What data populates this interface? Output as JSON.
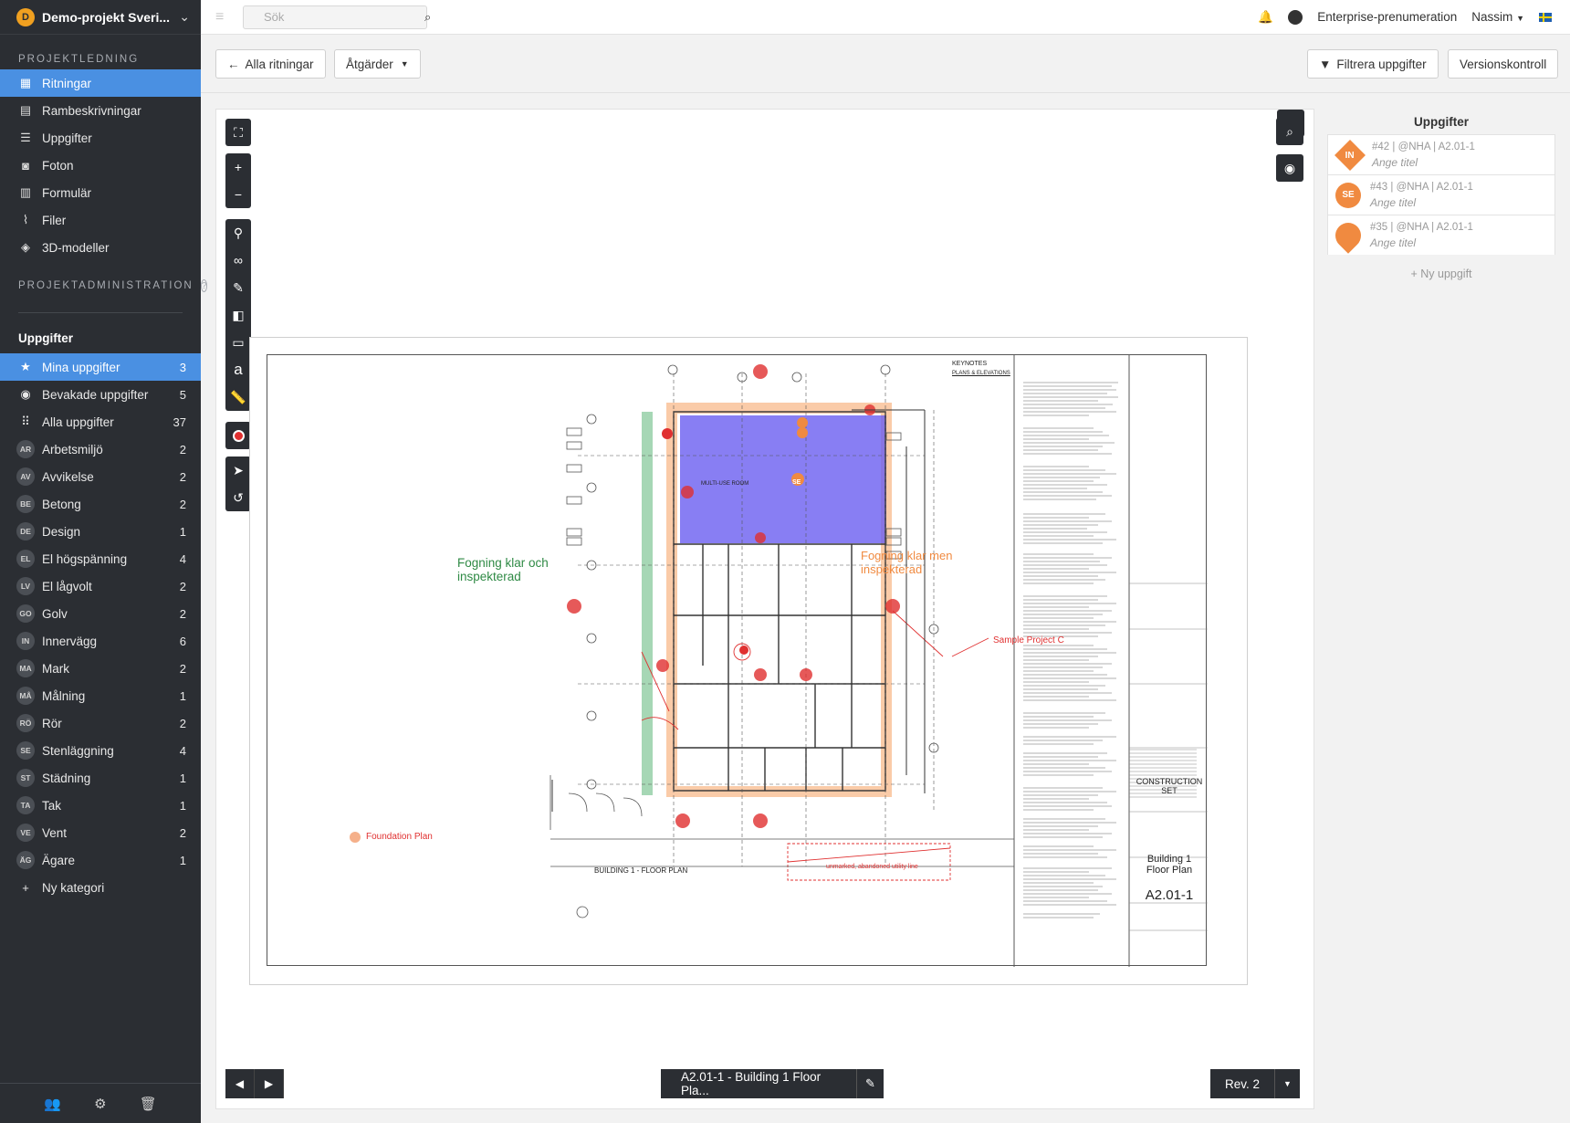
{
  "project": {
    "name": "Demo-projekt Sveri...",
    "logo_letter": "D"
  },
  "sidebar": {
    "section1_title": "PROJEKTLEDNING",
    "nav": [
      {
        "label": "Ritningar",
        "icon": "drawings-icon",
        "active": true
      },
      {
        "label": "Rambeskrivningar",
        "icon": "document-icon"
      },
      {
        "label": "Uppgifter",
        "icon": "list-icon"
      },
      {
        "label": "Foton",
        "icon": "camera-icon"
      },
      {
        "label": "Formulär",
        "icon": "clipboard-icon"
      },
      {
        "label": "Filer",
        "icon": "paperclip-icon"
      },
      {
        "label": "3D-modeller",
        "icon": "cube-icon"
      }
    ],
    "section2_title": "PROJEKTADMINISTRATION",
    "section2_help": "?",
    "tasks_heading": "Uppgifter",
    "filters": [
      {
        "label": "Mina uppgifter",
        "count": "3",
        "icon": "★",
        "active": true
      },
      {
        "label": "Bevakade uppgifter",
        "count": "5",
        "icon": "👁"
      },
      {
        "label": "Alla uppgifter",
        "count": "37",
        "icon": "⋮⋮"
      }
    ],
    "categories": [
      {
        "code": "AR",
        "label": "Arbetsmiljö",
        "count": "2"
      },
      {
        "code": "AV",
        "label": "Avvikelse",
        "count": "2"
      },
      {
        "code": "BE",
        "label": "Betong",
        "count": "2"
      },
      {
        "code": "DE",
        "label": "Design",
        "count": "1"
      },
      {
        "code": "EL",
        "label": "El högspänning",
        "count": "4"
      },
      {
        "code": "LV",
        "label": "El lågvolt",
        "count": "2"
      },
      {
        "code": "GO",
        "label": "Golv",
        "count": "2"
      },
      {
        "code": "IN",
        "label": "Innervägg",
        "count": "6"
      },
      {
        "code": "MA",
        "label": "Mark",
        "count": "2"
      },
      {
        "code": "MÅ",
        "label": "Målning",
        "count": "1"
      },
      {
        "code": "RÖ",
        "label": "Rör",
        "count": "2"
      },
      {
        "code": "SE",
        "label": "Stenläggning",
        "count": "4"
      },
      {
        "code": "ST",
        "label": "Städning",
        "count": "1"
      },
      {
        "code": "TA",
        "label": "Tak",
        "count": "1"
      },
      {
        "code": "VE",
        "label": "Vent",
        "count": "2"
      },
      {
        "code": "ÄG",
        "label": "Ägare",
        "count": "1"
      }
    ],
    "new_category": "Ny kategori"
  },
  "topbar": {
    "search_placeholder": "Sök",
    "subscription": "Enterprise-prenumeration",
    "user": "Nassim",
    "help": "?"
  },
  "toolbar": {
    "back_label": "Alla ritningar",
    "actions_label": "Åtgärder",
    "filter_label": "Filtrera uppgifter",
    "version_label": "Versionskontroll"
  },
  "viewer": {
    "annotations": {
      "green": "Fogning klar och\ninspekterad",
      "orange": "Fogning klar men\ninspekterad",
      "foundation": "Foundation Plan",
      "sample": "Sample Project C",
      "utility": "unmarked, abandoned utility line",
      "multi_use": "MULTI-USE ROOM",
      "pin_se": "SE"
    },
    "plan_title": "BUILDING 1 - FLOOR PLAN",
    "keynotes_title": "KEYNOTES",
    "keynotes_sub": "PLANS & ELEVATIONS",
    "titleblock": {
      "set": "CONSTRUCTION\nSET",
      "sheet_title": "Building 1\nFloor Plan",
      "sheet_no": "A2.01-1"
    },
    "sheet_selector": "A2.01-1 - Building 1 Floor Pla...",
    "revision": "Rev. 2"
  },
  "tasks_panel": {
    "title": "Uppgifter",
    "items": [
      {
        "badge": "IN",
        "meta": "#42 | @NHA | A2.01-1",
        "title": "Ange titel",
        "shape": "diamond"
      },
      {
        "badge": "SE",
        "meta": "#43 | @NHA | A2.01-1",
        "title": "Ange titel",
        "shape": "circle"
      },
      {
        "badge": "",
        "meta": "#35 | @NHA | A2.01-1",
        "title": "Ange titel",
        "shape": "pin"
      }
    ],
    "new_task": "+ Ny uppgift"
  },
  "colors": {
    "sidebar_bg": "#2b2e33",
    "accent": "#4a90e2",
    "task_orange": "#f08a40",
    "zone_blue": "#6a5ef0",
    "zone_green": "#3aa65a",
    "zone_orange": "#f5a060",
    "markup_red": "#e03030"
  }
}
